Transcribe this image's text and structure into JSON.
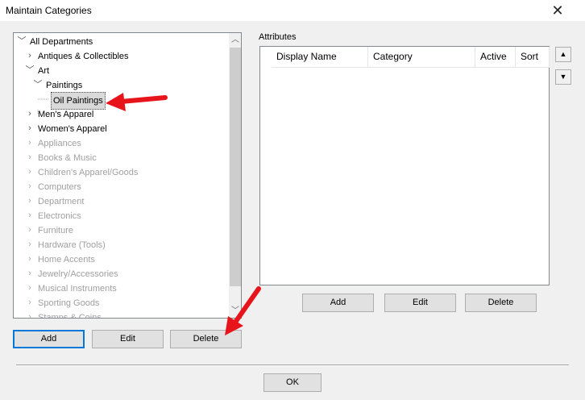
{
  "window": {
    "title": "Maintain Categories",
    "close_icon": "close-icon"
  },
  "tree": {
    "items": [
      {
        "label": "All Departments",
        "expander": "collapse"
      },
      {
        "label": "Antiques & Collectibles",
        "expander": "expand"
      },
      {
        "label": "Art",
        "expander": "collapse"
      },
      {
        "label": "Paintings",
        "expander": "collapse"
      },
      {
        "label": "Oil Paintings",
        "expander": "none"
      },
      {
        "label": "Men's Apparel",
        "expander": "expand"
      },
      {
        "label": "Women's Apparel",
        "expander": "expand"
      },
      {
        "label": "Appliances",
        "expander": "expand"
      },
      {
        "label": "Books & Music",
        "expander": "expand"
      },
      {
        "label": "Children's Apparel/Goods",
        "expander": "expand"
      },
      {
        "label": "Computers",
        "expander": "expand"
      },
      {
        "label": "Department",
        "expander": "expand"
      },
      {
        "label": "Electronics",
        "expander": "expand"
      },
      {
        "label": "Furniture",
        "expander": "expand"
      },
      {
        "label": "Hardware (Tools)",
        "expander": "expand"
      },
      {
        "label": "Home Accents",
        "expander": "expand"
      },
      {
        "label": "Jewelry/Accessories",
        "expander": "expand"
      },
      {
        "label": "Musical Instruments",
        "expander": "expand"
      },
      {
        "label": "Sporting Goods",
        "expander": "expand"
      },
      {
        "label": "Stamps & Coins",
        "expander": "expand"
      }
    ],
    "selected": "Oil Paintings",
    "buttons": {
      "add": "Add",
      "edit": "Edit",
      "delete": "Delete"
    }
  },
  "attributes": {
    "label": "Attributes",
    "columns": [
      "Display Name",
      "Category",
      "Active",
      "Sort"
    ],
    "rows": [],
    "buttons": {
      "add": "Add",
      "edit": "Edit",
      "delete": "Delete"
    },
    "move_up_icon": "arrow-up-icon",
    "move_down_icon": "arrow-down-icon"
  },
  "footer": {
    "ok": "OK"
  },
  "annotations": {
    "arrow_color": "#e8141b"
  }
}
